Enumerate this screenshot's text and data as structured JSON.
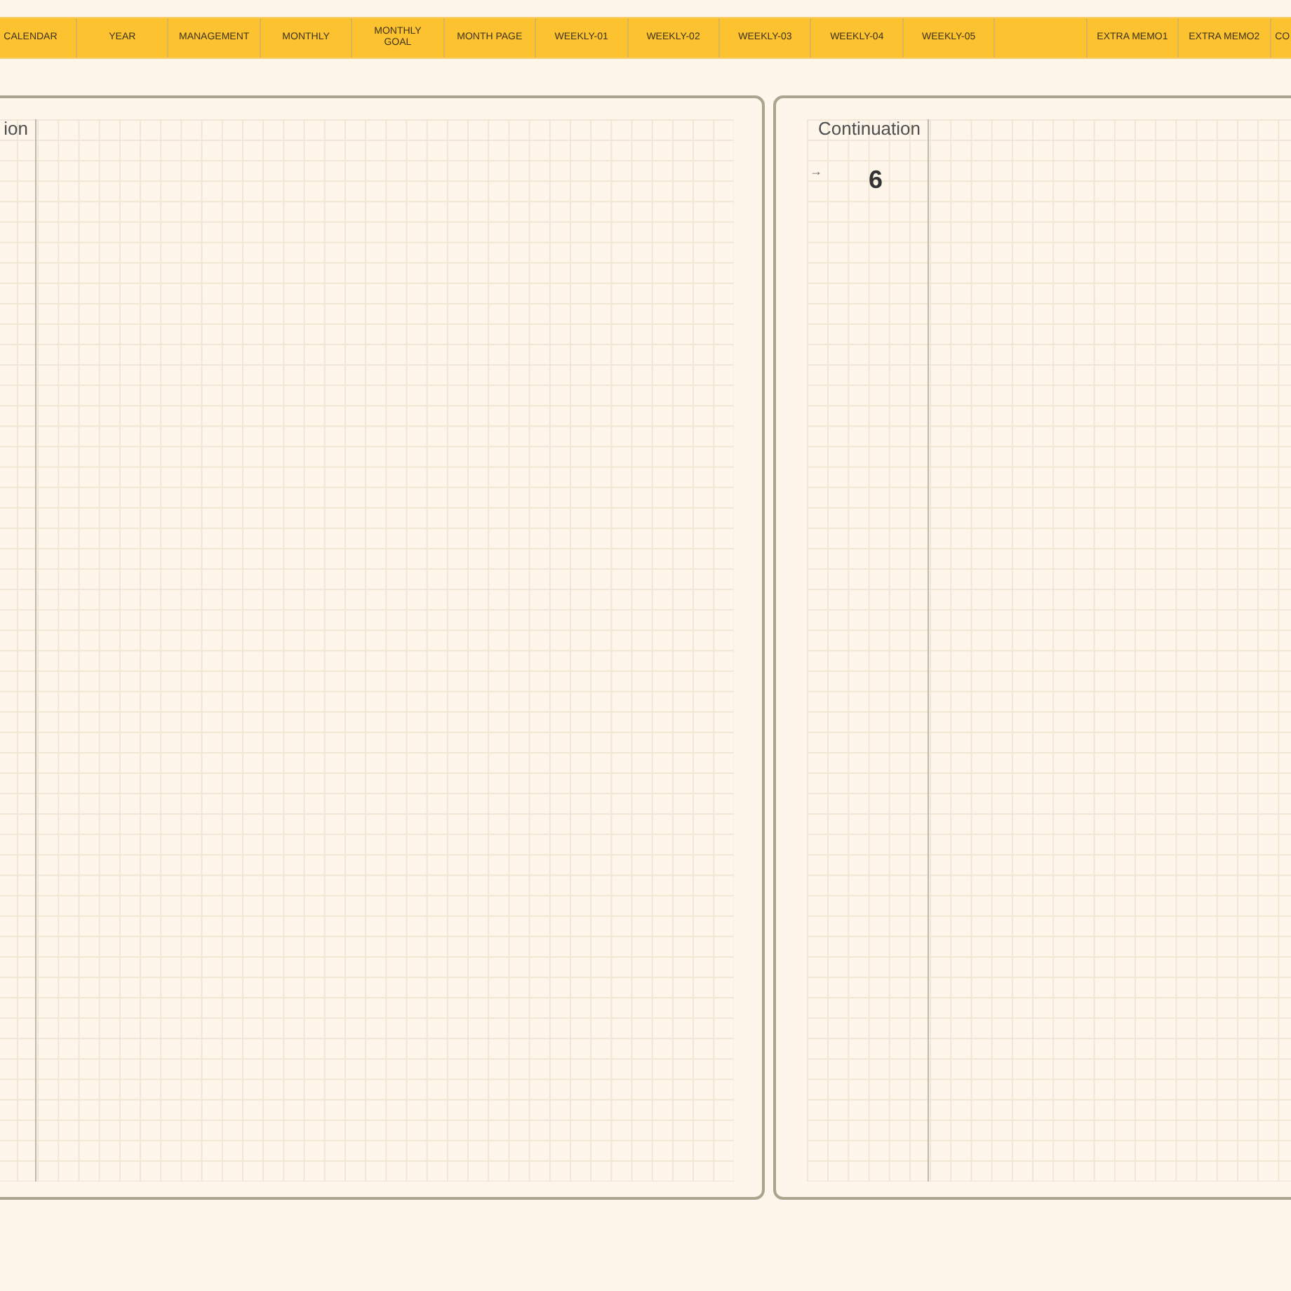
{
  "tabs": [
    {
      "kind": "text",
      "label": "CALENDAR"
    },
    {
      "kind": "text",
      "label": "YEAR"
    },
    {
      "kind": "text",
      "label": "MANAGEMENT"
    },
    {
      "kind": "text",
      "label": "MONTHLY"
    },
    {
      "kind": "text",
      "label": "MONTHLY\nGOAL"
    },
    {
      "kind": "text",
      "label": "MONTH PAGE"
    },
    {
      "kind": "text",
      "label": "WEEKLY-01"
    },
    {
      "kind": "text",
      "label": "WEEKLY-02"
    },
    {
      "kind": "text",
      "label": "WEEKLY-03"
    },
    {
      "kind": "text",
      "label": "WEEKLY-04"
    },
    {
      "kind": "text",
      "label": "WEEKLY-05"
    },
    {
      "kind": "blank"
    },
    {
      "kind": "text",
      "label": "EXTRA MEMO1"
    },
    {
      "kind": "text",
      "label": "EXTRA MEMO2"
    },
    {
      "kind": "text",
      "label": "CO"
    }
  ],
  "pages": [
    {
      "heading": "ion"
    },
    {
      "heading": "Continuation",
      "arrow": "→",
      "page_number": "6"
    }
  ]
}
